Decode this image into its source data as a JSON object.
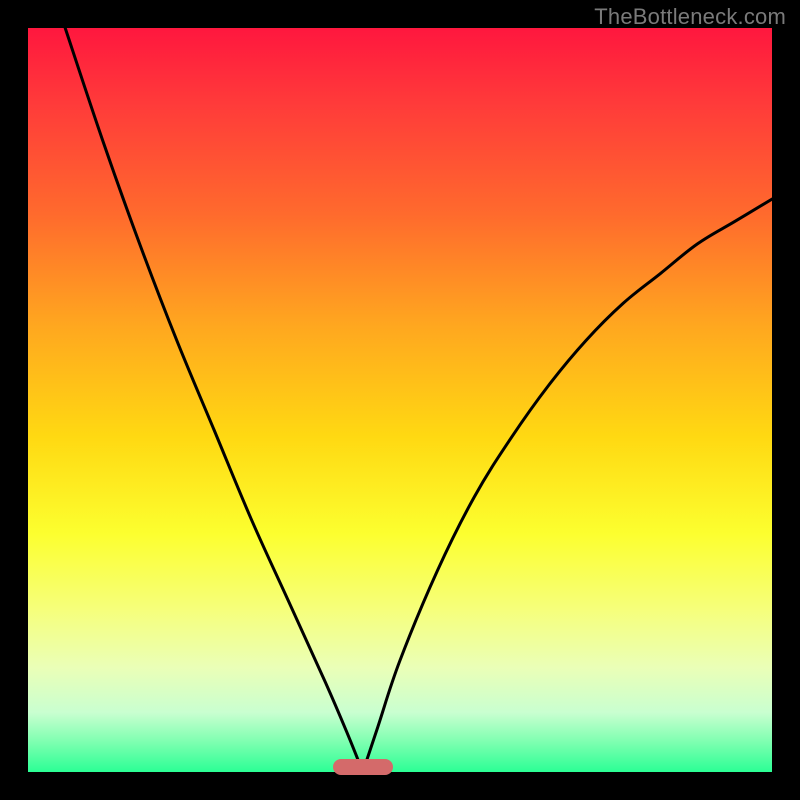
{
  "watermark": "TheBottleneck.com",
  "chart_data": {
    "type": "line",
    "title": "",
    "xlabel": "",
    "ylabel": "",
    "xlim": [
      0,
      100
    ],
    "ylim": [
      0,
      100
    ],
    "grid": false,
    "legend": false,
    "background_gradient": [
      "#ff173e",
      "#ffa71f",
      "#fcff2f",
      "#2bff95"
    ],
    "marker": {
      "x_start": 41,
      "x_end": 49,
      "y": 0,
      "color": "#d46a6a"
    },
    "series": [
      {
        "name": "left-curve",
        "x": [
          5,
          10,
          15,
          20,
          25,
          30,
          35,
          40,
          43,
          45
        ],
        "y": [
          100,
          85,
          71,
          58,
          46,
          34,
          23,
          12,
          5,
          0
        ]
      },
      {
        "name": "right-curve",
        "x": [
          45,
          47,
          50,
          55,
          60,
          65,
          70,
          75,
          80,
          85,
          90,
          95,
          100
        ],
        "y": [
          0,
          6,
          15,
          27,
          37,
          45,
          52,
          58,
          63,
          67,
          71,
          74,
          77
        ]
      }
    ]
  }
}
